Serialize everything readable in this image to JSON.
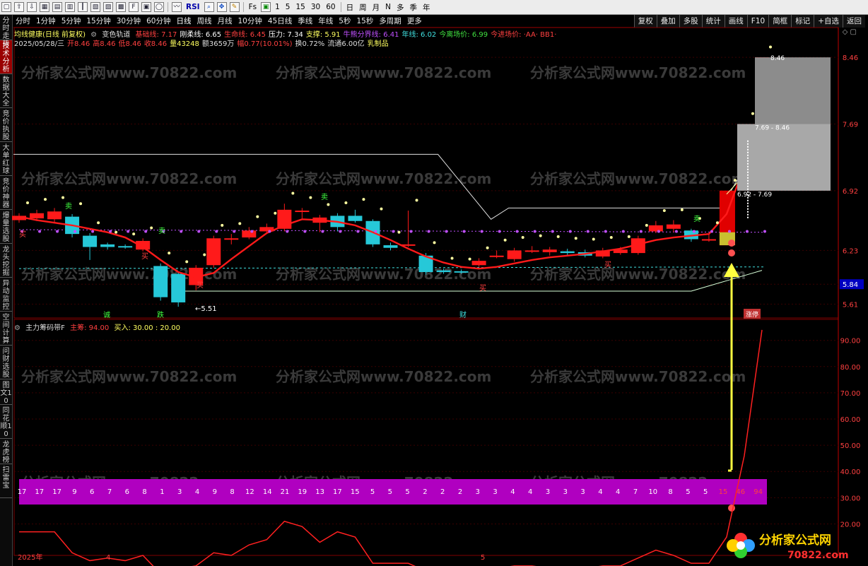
{
  "toolbar": {
    "icons": [
      "square-icon",
      "arrow-up-icon",
      "arrow-down-icon",
      "grid-icon",
      "table-icon",
      "bar-chart-icon",
      "candle-icon",
      "chart-icon",
      "chart2-icon",
      "f10-icon",
      "fz-icon",
      "chart3-icon",
      "circle-icon",
      "line-icon",
      "rsi-icon",
      "zoom-icon",
      "crosshair-icon",
      "pen-icon",
      "fs-icon",
      "window-icon"
    ],
    "rsi_label": "RSI",
    "fs_label": "Fs",
    "periods": [
      "1",
      "5",
      "15",
      "30",
      "60"
    ],
    "cycles": [
      "日",
      "周",
      "月",
      "N",
      "多",
      "季",
      "年"
    ]
  },
  "menubar": {
    "left": [
      "分时",
      "1分钟",
      "5分钟",
      "15分钟",
      "30分钟",
      "60分钟",
      "日线",
      "周线",
      "月线",
      "10分钟",
      "45日线",
      "季线",
      "年线",
      "5秒",
      "15秒",
      "多周期",
      "更多"
    ],
    "right": [
      "复权",
      "叠加",
      "多股",
      "统计",
      "画线",
      "F10",
      "简框",
      "标记",
      "+自选",
      "返回"
    ]
  },
  "sidebar": [
    "分时走势",
    "技术分析",
    "数据大全",
    "竞价执股",
    "大单红球",
    "竞价神器",
    "爆量选股",
    "龙头挖掘",
    "异动监控",
    "空间计算",
    "问财选股",
    "图文10",
    "同花顺10",
    "龙虎榜",
    "扫雷宝"
  ],
  "info_line1": {
    "title": "均线健康(日线 前复权)",
    "indicator": "变色轨道",
    "items": [
      {
        "label": "基础线: 7.17",
        "color": "#ff4040"
      },
      {
        "label": "刚柔线: 6.65",
        "color": "#ffffff"
      },
      {
        "label": "生命线: 6.45",
        "color": "#ff4040"
      },
      {
        "label": "压力: 7.34",
        "color": "#ffffff"
      },
      {
        "label": "支撑: 5.91",
        "color": "#ffff60"
      },
      {
        "label": "牛熊分界线: 6.41",
        "color": "#c050ff"
      },
      {
        "label": "年线: 6.02",
        "color": "#40e0e0"
      },
      {
        "label": "今离场价: 6.99",
        "color": "#40e040"
      },
      {
        "label": "今进场价: ·AA· BB1·",
        "color": "#ff4040"
      }
    ]
  },
  "info_line2": {
    "items": [
      {
        "label": "2025/05/28/三",
        "color": "#dddddd"
      },
      {
        "label": "开8.46",
        "color": "#ff4040"
      },
      {
        "label": "高8.46",
        "color": "#ff4040"
      },
      {
        "label": "低8.46",
        "color": "#ff4040"
      },
      {
        "label": "收8.46",
        "color": "#ff4040"
      },
      {
        "label": "量43248",
        "color": "#ffff60"
      },
      {
        "label": "额3659万",
        "color": "#dddddd"
      },
      {
        "label": "幅0.77(10.01%)",
        "color": "#ff4040"
      },
      {
        "label": "换0.72%",
        "color": "#dddddd"
      },
      {
        "label": "流通6.00亿",
        "color": "#dddddd"
      },
      {
        "label": "乳制品",
        "color": "#ffff60"
      }
    ]
  },
  "main_axis": [
    "8.46",
    "7.69",
    "6.92",
    "6.23",
    "5.84",
    "5.61"
  ],
  "sub_axis": [
    "90.00",
    "80.00",
    "70.00",
    "60.00",
    "50.00",
    "40.00",
    "30.00",
    "20.00"
  ],
  "price_boxes": [
    {
      "label": "8.46"
    },
    {
      "label": "7.69 - 8.46"
    },
    {
      "label": "6.92 - 7.69"
    }
  ],
  "low_label": "←5.51",
  "sub_header": {
    "title": "主力筹码带F",
    "main_label": "主筹: 94.00",
    "buy_label": "买入: 30.00 : 20.00"
  },
  "band_values": [
    "17",
    "17",
    "17",
    "9",
    "6",
    "7",
    "6",
    "8",
    "1",
    "3",
    "4",
    "9",
    "8",
    "12",
    "14",
    "21",
    "19",
    "13",
    "17",
    "15",
    "5",
    "5",
    "5",
    "2",
    "2",
    "2",
    "3",
    "3",
    "4",
    "4",
    "3",
    "3",
    "3",
    "4",
    "4",
    "7",
    "10",
    "8",
    "5",
    "5",
    "15",
    "46",
    "94"
  ],
  "chart_markers": {
    "sell": "卖",
    "buy": "买",
    "buy2": "买",
    "cheng": "诚",
    "jie": "跌",
    "cai": "财",
    "zhangting": "涨停"
  },
  "x_axis": [
    "2025年",
    "4",
    "5"
  ],
  "watermark": "分析家公式网www.70822.com",
  "logo": {
    "title": "分析家公式网",
    "url": "70822.com"
  },
  "colors": {
    "up": "#ff1a1a",
    "down": "#26c8d8",
    "accent": "#ffff00",
    "band": "#b000c0"
  },
  "chart_data": {
    "type": "candlestick",
    "candles": [
      {
        "o": 6.58,
        "c": 6.63,
        "h": 6.66,
        "l": 6.55
      },
      {
        "o": 6.6,
        "c": 6.66,
        "h": 6.7,
        "l": 6.57
      },
      {
        "o": 6.59,
        "c": 6.68,
        "h": 6.72,
        "l": 6.56
      },
      {
        "o": 6.62,
        "c": 6.42,
        "h": 6.65,
        "l": 6.38
      },
      {
        "o": 6.4,
        "c": 6.27,
        "h": 6.43,
        "l": 6.12
      },
      {
        "o": 6.3,
        "c": 6.27,
        "h": 6.32,
        "l": 6.24
      },
      {
        "o": 6.28,
        "c": 6.27,
        "h": 6.3,
        "l": 6.25
      },
      {
        "o": 6.24,
        "c": 6.34,
        "h": 6.37,
        "l": 6.22
      },
      {
        "o": 6.05,
        "c": 5.69,
        "h": 6.08,
        "l": 5.65
      },
      {
        "o": 5.96,
        "c": 5.63,
        "h": 5.98,
        "l": 5.58
      },
      {
        "o": 5.83,
        "c": 6.03,
        "h": 6.06,
        "l": 5.77
      },
      {
        "o": 6.06,
        "c": 6.37,
        "h": 6.4,
        "l": 6.03
      },
      {
        "o": 6.37,
        "c": 6.37,
        "h": 6.42,
        "l": 6.3
      },
      {
        "o": 6.38,
        "c": 6.46,
        "h": 6.5,
        "l": 6.36
      },
      {
        "o": 6.45,
        "c": 6.5,
        "h": 6.54,
        "l": 6.42
      },
      {
        "o": 6.48,
        "c": 6.7,
        "h": 6.77,
        "l": 6.45
      },
      {
        "o": 6.69,
        "c": 6.69,
        "h": 6.72,
        "l": 6.6
      },
      {
        "o": 6.55,
        "c": 6.61,
        "h": 6.64,
        "l": 6.44
      },
      {
        "o": 6.63,
        "c": 6.5,
        "h": 6.66,
        "l": 6.45
      },
      {
        "o": 6.63,
        "c": 6.57,
        "h": 6.7,
        "l": 6.55
      },
      {
        "o": 6.57,
        "c": 6.3,
        "h": 6.59,
        "l": 6.27
      },
      {
        "o": 6.29,
        "c": 6.26,
        "h": 6.32,
        "l": 6.23
      },
      {
        "o": 6.3,
        "c": 6.3,
        "h": 6.69,
        "l": 6.27
      },
      {
        "o": 6.17,
        "c": 5.98,
        "h": 6.2,
        "l": 5.95
      },
      {
        "o": 6.0,
        "c": 5.98,
        "h": 6.02,
        "l": 5.96
      },
      {
        "o": 5.99,
        "c": 5.98,
        "h": 6.01,
        "l": 5.96
      },
      {
        "o": 6.06,
        "c": 6.11,
        "h": 6.14,
        "l": 6.04
      },
      {
        "o": 6.17,
        "c": 6.17,
        "h": 6.23,
        "l": 6.14
      },
      {
        "o": 6.13,
        "c": 6.23,
        "h": 6.26,
        "l": 6.1
      },
      {
        "o": 6.23,
        "c": 6.23,
        "h": 6.28,
        "l": 6.2
      },
      {
        "o": 6.21,
        "c": 6.24,
        "h": 6.27,
        "l": 6.17
      },
      {
        "o": 6.22,
        "c": 6.2,
        "h": 6.25,
        "l": 6.17
      },
      {
        "o": 6.21,
        "c": 6.17,
        "h": 6.24,
        "l": 6.15
      },
      {
        "o": 6.16,
        "c": 6.23,
        "h": 6.26,
        "l": 6.14
      },
      {
        "o": 6.2,
        "c": 6.24,
        "h": 6.27,
        "l": 6.18
      },
      {
        "o": 6.2,
        "c": 6.37,
        "h": 6.4,
        "l": 6.18
      },
      {
        "o": 6.45,
        "c": 6.52,
        "h": 6.57,
        "l": 6.43
      },
      {
        "o": 6.48,
        "c": 6.53,
        "h": 6.58,
        "l": 6.44
      },
      {
        "o": 6.46,
        "c": 6.36,
        "h": 6.48,
        "l": 6.33
      },
      {
        "o": 6.36,
        "c": 6.36,
        "h": 6.43,
        "l": 6.33
      },
      {
        "o": 6.29,
        "c": 6.92,
        "h": 6.92,
        "l": 6.29
      },
      {
        "o": 7.69,
        "c": 7.69,
        "h": 7.69,
        "l": 7.69
      },
      {
        "o": 8.46,
        "c": 8.46,
        "h": 8.46,
        "l": 8.46
      }
    ],
    "band": [
      17,
      17,
      17,
      9,
      6,
      7,
      6,
      8,
      1,
      3,
      4,
      9,
      8,
      12,
      14,
      21,
      19,
      13,
      17,
      15,
      5,
      5,
      5,
      2,
      2,
      2,
      3,
      3,
      4,
      4,
      3,
      3,
      3,
      4,
      4,
      7,
      10,
      8,
      5,
      5,
      15,
      46,
      94
    ],
    "ma": [
      6.62,
      6.58,
      6.55,
      6.52,
      6.48,
      6.44,
      6.38,
      6.27,
      6.12,
      5.98,
      5.92,
      5.97,
      6.13,
      6.28,
      6.43,
      6.52,
      6.59,
      6.58,
      6.56,
      6.52,
      6.44,
      6.35,
      6.25,
      6.16,
      6.09,
      6.04,
      6.02,
      6.04,
      6.08,
      6.12,
      6.15,
      6.17,
      6.19,
      6.22,
      6.25,
      6.3,
      6.35,
      6.38,
      6.4,
      6.42,
      6.65,
      7.2,
      7.65
    ],
    "ylim": [
      5.45,
      8.6
    ],
    "sub_ylim": [
      8,
      98
    ]
  }
}
